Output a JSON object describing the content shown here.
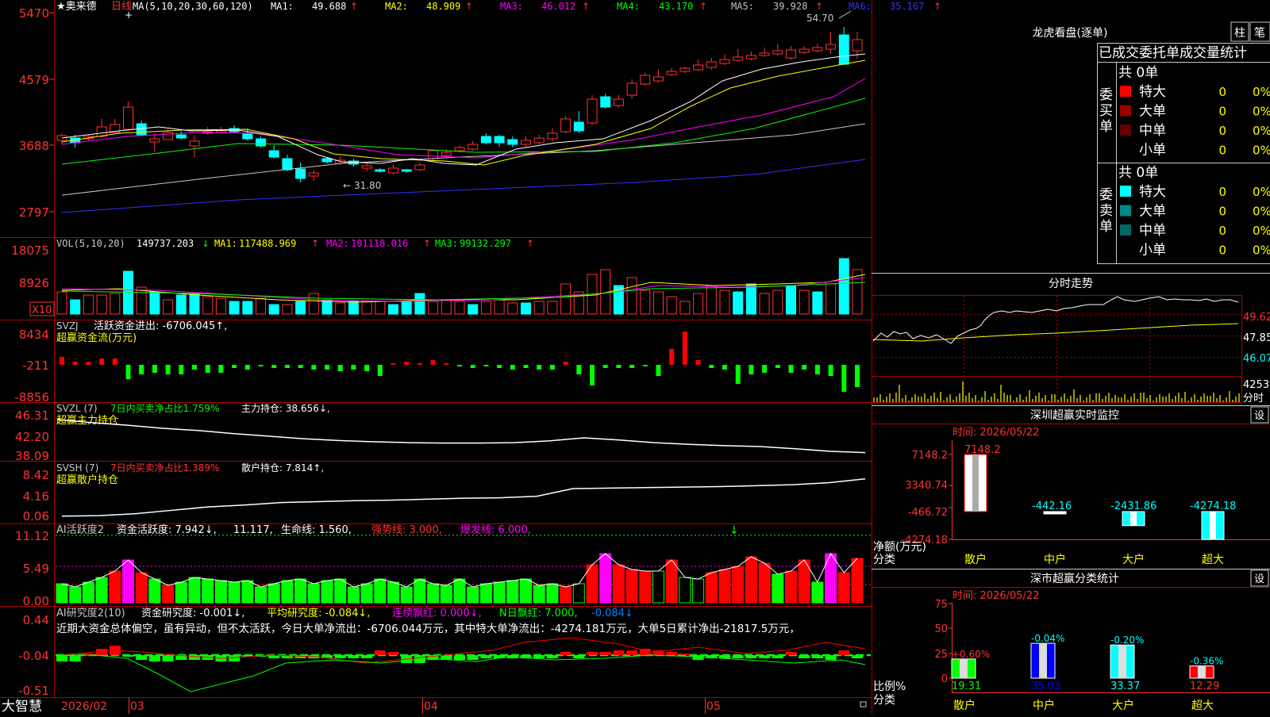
{
  "stock": {
    "name": "★奥来德",
    "period": "日线"
  },
  "main": {
    "ma_header": "MA(5,10,20,30,60,120)",
    "ma_values": [
      {
        "label": "MA1:",
        "value": "49.688",
        "arrow": "↑",
        "color": "#ffffff"
      },
      {
        "label": "MA2:",
        "value": "48.909",
        "arrow": "↑",
        "color": "#ffff00"
      },
      {
        "label": "MA3:",
        "value": "46.012",
        "arrow": "↑",
        "color": "#ff00ff"
      },
      {
        "label": "MA4:",
        "value": "43.170",
        "arrow": "↑",
        "color": "#00ff00"
      },
      {
        "label": "MA5:",
        "value": "39.928",
        "arrow": "↑",
        "color": "#c0c0c0"
      },
      {
        "label": "MA6:",
        "value": "35.167",
        "arrow": "↑",
        "color": "#3333ff"
      }
    ],
    "y_ticks": [
      "5470",
      "4579",
      "3688",
      "2797"
    ],
    "high_label": "54.70",
    "low_label": "31.80"
  },
  "vol": {
    "header": "VOL(5,10,20)",
    "value": "149737.203",
    "ma": [
      {
        "label": "MA1:",
        "value": "117488.969",
        "color": "#ffff00"
      },
      {
        "label": "MA2:",
        "value": "101118.016",
        "color": "#ff00ff"
      },
      {
        "label": "MA3:",
        "value": "99132.297",
        "color": "#00ff00"
      }
    ],
    "y_ticks": [
      "18075",
      "8926"
    ],
    "unit": "X10"
  },
  "svzj": {
    "header": "SVZJ",
    "line1": "活跃资金进出: -6706.045↑,",
    "line2": "超赢资金流(万元)",
    "y_ticks": [
      "8434",
      "-211",
      "-8856"
    ]
  },
  "svzl": {
    "header": "SVZL (7)",
    "text1": "7日内买卖净占比1.759%",
    "text2": "主力持仓: 38.656↓,",
    "line2": "超赢主力持仓",
    "y_ticks": [
      "46.31",
      "42.20",
      "38.09"
    ]
  },
  "svsh": {
    "header": "SVSH (7)",
    "text1": "7日内买卖净占比1.389%",
    "text2": "散户持仓: 7.814↑,",
    "line2": "超赢散户持仓",
    "y_ticks": [
      "8.42",
      "4.16",
      "0.06"
    ]
  },
  "ai1": {
    "header": "AI活跃度2",
    "t1": "资金活跃度: 7.942↓,",
    "t2": "11.117,",
    "t3": "生命线: 1.560,",
    "t4": "强势线: 3.000,",
    "t5": "爆发线: 6.000,",
    "y_ticks": [
      "11.12",
      "5.49",
      "0.00"
    ]
  },
  "ai2": {
    "header": "AI研究度2(10)",
    "t1": "资金研究度: -0.001↓,",
    "t2": "平均研究度: -0.084↓,",
    "t3": "连续飘红: 0.000↓,",
    "t4": "N日飘红: 7.000,",
    "t5": "-0.084↓",
    "comment": "近期大资金总体偏空，虽有异动，但不太活跃，今日大单净流出：-6706.044万元，其中特大单净流出：-4274.181万元，大单5日累计净出-21817.5万元，",
    "y_ticks": [
      "0.44",
      "-0.04",
      "-0.51"
    ]
  },
  "bottom": {
    "brand": "大智慧",
    "dates": [
      "2026/02",
      "03",
      "04",
      "05"
    ]
  },
  "dragon": {
    "title": "龙虎看盘(逐单)",
    "tab1": "柱",
    "tab2": "笔",
    "header": "已成交委托单成交量统计",
    "buy_label": "委买单",
    "sell_label": "委卖单",
    "buy_total": "共 0单",
    "sell_total": "共 0单",
    "rows": [
      "特大",
      "大单",
      "中单",
      "小单"
    ],
    "count": "0",
    "pct": "0%",
    "buy_colors": [
      "#ff0000",
      "#990000",
      "#660000",
      "#000000"
    ],
    "sell_colors": [
      "#00ffff",
      "#008888",
      "#006666",
      "#000000"
    ]
  },
  "fenshi": {
    "title": "分时走势",
    "y_ticks": [
      "49.62",
      "47.85",
      "46.07"
    ],
    "vol_tick": "4253",
    "unit": "分时"
  },
  "shenzhen_rt": {
    "title": "深圳超赢实时监控",
    "settings": "设",
    "time": "时间: 2026/05/22",
    "y_ticks": [
      "7148.2",
      "3340.74",
      "-466.72",
      "-4274.18"
    ],
    "ylabel": "净额(万元)",
    "xlabel": "分类",
    "categories": [
      "散户",
      "中户",
      "大户",
      "超大"
    ],
    "values": [
      "7148.2",
      "-442.16",
      "-2431.86",
      "-4274.18"
    ]
  },
  "shenzhen_cls": {
    "title": "深市超赢分类统计",
    "settings": "设",
    "time": "时间: 2026/05/22",
    "y_ticks": [
      "75",
      "50",
      "25",
      "0"
    ],
    "ylabel": "比例%",
    "xlabel": "分类",
    "categories": [
      "散户",
      "中户",
      "大户",
      "超大"
    ],
    "values": [
      "19.31",
      "35.03",
      "33.37",
      "12.29"
    ],
    "changes": [
      "+0.60%",
      "-0.04%",
      "-0.20%",
      "-0.36%"
    ]
  },
  "chart_data": [
    {
      "type": "bar",
      "title": "深圳超赢实时监控",
      "categories": [
        "散户",
        "中户",
        "大户",
        "超大"
      ],
      "values": [
        7148.2,
        -442.16,
        -2431.86,
        -4274.18
      ],
      "ylabel": "净额(万元)",
      "xlabel": "分类",
      "ylim": [
        -4274.18,
        7148.2
      ]
    },
    {
      "type": "bar",
      "title": "深市超赢分类统计",
      "categories": [
        "散户",
        "中户",
        "大户",
        "超大"
      ],
      "values": [
        19.31,
        35.03,
        33.37,
        12.29
      ],
      "changes": [
        "+0.60%",
        "-0.04%",
        "-0.20%",
        "-0.36%"
      ],
      "ylabel": "比例%",
      "xlabel": "分类",
      "ylim": [
        0,
        75
      ]
    },
    {
      "type": "line",
      "title": "SVZL",
      "series": [
        {
          "name": "主力持仓",
          "values": [
            46.3,
            45.6,
            45.0,
            44.3,
            43.8,
            43.1,
            42.5,
            41.9,
            41.5,
            41.2,
            41.0,
            40.9,
            40.9,
            41.0,
            41.4,
            42.1,
            41.6,
            41.0,
            40.6,
            40.3,
            40.1,
            39.6,
            39.0,
            38.7
          ]
        }
      ],
      "ylim": [
        38.09,
        46.31
      ]
    },
    {
      "type": "line",
      "title": "SVSH",
      "series": [
        {
          "name": "散户持仓",
          "values": [
            0.1,
            0.2,
            0.6,
            1.3,
            2.0,
            2.4,
            2.9,
            3.1,
            3.3,
            3.4,
            3.6,
            3.8,
            3.9,
            4.2,
            5.8,
            5.9,
            6.0,
            6.1,
            6.2,
            6.4,
            6.6,
            7.0,
            7.8
          ]
        }
      ],
      "ylim": [
        0.06,
        8.42
      ]
    }
  ]
}
